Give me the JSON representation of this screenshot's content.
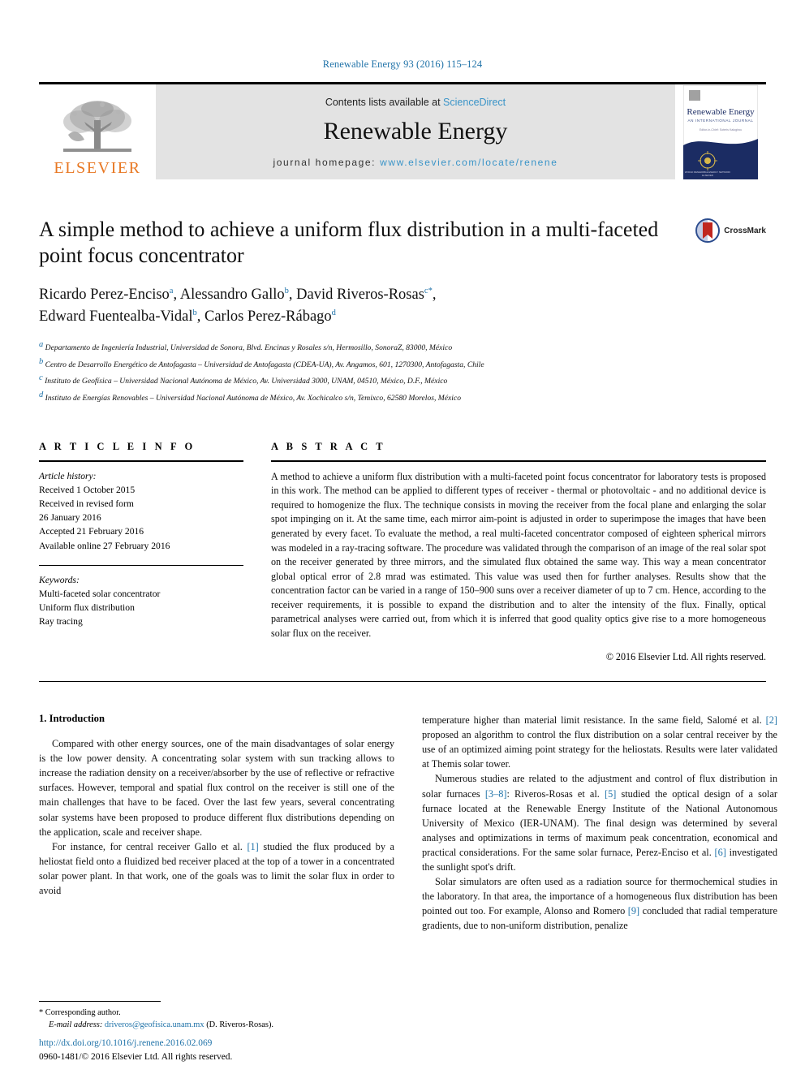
{
  "running_head": "Renewable Energy 93 (2016) 115–124",
  "masthead": {
    "contents_prefix": "Contents lists available at ",
    "sciencedirect": "ScienceDirect",
    "journal_name": "Renewable Energy",
    "homepage_prefix": "journal homepage: ",
    "homepage_url": "www.elsevier.com/locate/renene",
    "publisher": "ELSEVIER",
    "cover_title": "Renewable Energy",
    "cover_subtitle": "AN INTERNATIONAL JOURNAL"
  },
  "article": {
    "title": "A simple method to achieve a uniform flux distribution in a multi-faceted point focus concentrator",
    "crossmark_label": "CrossMark",
    "authors": [
      {
        "name": "Ricardo Perez-Enciso",
        "sup": "a",
        "sep": ", "
      },
      {
        "name": "Alessandro Gallo",
        "sup": "b",
        "sep": ", "
      },
      {
        "name": "David Riveros-Rosas",
        "sup": "c",
        "star": "*",
        "sep": ","
      },
      {
        "name": "Edward Fuentealba-Vidal",
        "sup": "b",
        "sep": ", "
      },
      {
        "name": "Carlos Perez-Rábago",
        "sup": "d",
        "sep": ""
      }
    ],
    "affiliations": [
      {
        "mark": "a",
        "text": "Departamento de Ingeniería Industrial, Universidad de Sonora, Blvd. Encinas y Rosales s/n, Hermosillo, SonoraZ, 83000, México"
      },
      {
        "mark": "b",
        "text": "Centro de Desarrollo Energético de Antofagasta – Universidad de Antofagasta (CDEA-UA), Av. Angamos, 601, 1270300, Antofagasta, Chile"
      },
      {
        "mark": "c",
        "text": "Instituto de Geofísica – Universidad Nacional Autónoma de México, Av. Universidad 3000, UNAM, 04510, México, D.F., México"
      },
      {
        "mark": "d",
        "text": "Instituto de Energías Renovables – Universidad Nacional Autónoma de México, Av. Xochicalco s/n, Temixco, 62580 Morelos, México"
      }
    ]
  },
  "article_info": {
    "heading": "A R T I C L E   I N F O",
    "history_label": "Article history:",
    "history": [
      "Received 1 October 2015",
      "Received in revised form",
      "26 January 2016",
      "Accepted 21 February 2016",
      "Available online 27 February 2016"
    ],
    "keywords_label": "Keywords:",
    "keywords": [
      "Multi-faceted solar concentrator",
      "Uniform flux distribution",
      "Ray tracing"
    ]
  },
  "abstract": {
    "heading": "A B S T R A C T",
    "text": "A method to achieve a uniform flux distribution with a multi-faceted point focus concentrator for laboratory tests is proposed in this work. The method can be applied to different types of receiver - thermal or photovoltaic - and no additional device is required to homogenize the flux. The technique consists in moving the receiver from the focal plane and enlarging the solar spot impinging on it. At the same time, each mirror aim-point is adjusted in order to superimpose the images that have been generated by every facet. To evaluate the method, a real multi-faceted concentrator composed of eighteen spherical mirrors was modeled in a ray-tracing software. The procedure was validated through the comparison of an image of the real solar spot on the receiver generated by three mirrors, and the simulated flux obtained the same way. This way a mean concentrator global optical error of 2.8 mrad was estimated. This value was used then for further analyses. Results show that the concentration factor can be varied in a range of 150–900 suns over a receiver diameter of up to 7 cm. Hence, according to the receiver requirements, it is possible to expand the distribution and to alter the intensity of the flux. Finally, optical parametrical analyses were carried out, from which it is inferred that good quality optics give rise to a more homogeneous solar flux on the receiver.",
    "copyright": "© 2016 Elsevier Ltd. All rights reserved."
  },
  "body": {
    "section_title": "1.  Introduction",
    "left_paragraphs": [
      "Compared with other energy sources, one of the main disadvantages of solar energy is the low power density. A concentrating solar system with sun tracking allows to increase the radiation density on a receiver/absorber by the use of reflective or refractive surfaces. However, temporal and spatial flux control on the receiver is still one of the main challenges that have to be faced. Over the last few years, several concentrating solar systems have been proposed to produce different flux distributions depending on the application, scale and receiver shape.",
      "For instance, for central receiver Gallo et al. [1] studied the flux produced by a heliostat field onto a fluidized bed receiver placed at the top of a tower in a concentrated solar power plant. In that work, one of the goals was to limit the solar flux in order to avoid"
    ],
    "right_paragraphs": [
      "temperature higher than material limit resistance. In the same field, Salomé et al. [2] proposed an algorithm to control the flux distribution on a solar central receiver by the use of an optimized aiming point strategy for the heliostats. Results were later validated at Themis solar tower.",
      "Numerous studies are related to the adjustment and control of flux distribution in solar furnaces [3–8]: Riveros-Rosas et al. [5] studied the optical design of a solar furnace located at the Renewable Energy Institute of the National Autonomous University of Mexico (IER-UNAM). The final design was determined by several analyses and optimizations in terms of maximum peak concentration, economical and practical considerations. For the same solar furnace, Perez-Enciso et al. [6] investigated the sunlight spot's drift.",
      "Solar simulators are often used as a radiation source for thermochemical studies in the laboratory. In that area, the importance of a homogeneous flux distribution has been pointed out too. For example, Alonso and Romero [9] concluded that radial temperature gradients, due to non-uniform distribution, penalize"
    ]
  },
  "footnotes": {
    "corresponding": "*  Corresponding author.",
    "email_label": "E-mail address:",
    "email": "driveros@geofisica.unam.mx",
    "email_suffix": "(D. Riveros-Rosas)."
  },
  "footer": {
    "doi": "http://dx.doi.org/10.1016/j.renene.2016.02.069",
    "issn": "0960-1481/© 2016 Elsevier Ltd. All rights reserved."
  },
  "colors": {
    "link": "#1f72a8",
    "elsevier_orange": "#E87722",
    "masthead_grey": "#e3e3e3",
    "cover_navy": "#1b2c63"
  }
}
